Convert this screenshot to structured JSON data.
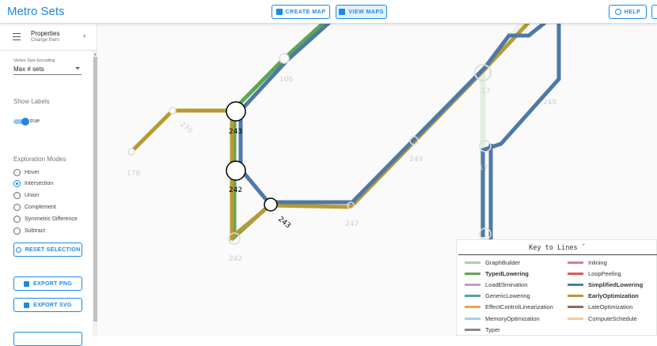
{
  "header": {
    "title": "Metro Sets",
    "create_map": "CREATE MAP",
    "view_maps": "VIEW MAPS",
    "help": "HELP"
  },
  "sidebar": {
    "panel_title": "Properties",
    "panel_subtitle": "Change them",
    "collapse_glyph": "‹",
    "vertex_label": "Vertex Size Encoding",
    "vertex_value": "Max # sets",
    "show_labels": "Show Labels",
    "toggle_value": "true",
    "exploration_title": "Exploration Modes",
    "modes": [
      {
        "label": "Hover",
        "selected": false
      },
      {
        "label": "Intersection",
        "selected": true
      },
      {
        "label": "Union",
        "selected": false
      },
      {
        "label": "Complement",
        "selected": false
      },
      {
        "label": "Symmetric Difference",
        "selected": false
      },
      {
        "label": "Subtract",
        "selected": false
      }
    ],
    "reset_button": "RESET SELECTION",
    "export_png": "EXPORT PNG",
    "export_svg": "EXPORT SVG"
  },
  "map": {
    "labels": [
      {
        "text": "106"
      },
      {
        "text": "17"
      },
      {
        "text": "248"
      },
      {
        "text": "270"
      },
      {
        "text": "243"
      },
      {
        "text": "249"
      },
      {
        "text": "178"
      },
      {
        "text": "242"
      },
      {
        "text": "243"
      },
      {
        "text": "247"
      },
      {
        "text": "242"
      },
      {
        "text": "17"
      }
    ]
  },
  "legend": {
    "title": "Key to Lines",
    "title_mark": "ˇ",
    "left": [
      {
        "label": "GraphBuilder",
        "color": "#a5d6a7",
        "bold": false
      },
      {
        "label": "TypedLowering",
        "color": "#5fa654",
        "bold": true
      },
      {
        "label": "LoadElimination",
        "color": "#c39bc7",
        "bold": false
      },
      {
        "label": "GenericLowering",
        "color": "#4fa59a",
        "bold": false
      },
      {
        "label": "EffectControlLinearization",
        "color": "#f0a24a",
        "bold": false
      },
      {
        "label": "MemoryOptimization",
        "color": "#a9cde8",
        "bold": false
      },
      {
        "label": "Typer",
        "color": "#8a8a8a",
        "bold": false
      }
    ],
    "right": [
      {
        "label": "Inlining",
        "color": "#e07a91",
        "bold": false
      },
      {
        "label": "LoopPeeling",
        "color": "#e05a4e",
        "bold": false
      },
      {
        "label": "SimplifiedLowering",
        "color": "#4e79a7",
        "bold": true
      },
      {
        "label": "EarlyOptimization",
        "color": "#b89a33",
        "bold": true
      },
      {
        "label": "LateOptimization",
        "color": "#8a6a63",
        "bold": false
      },
      {
        "label": "ComputeSchedule",
        "color": "#f6c99a",
        "bold": false
      }
    ]
  },
  "colors": {
    "accent": "#1e88e5",
    "blue_line": "#4e79a7",
    "gold_line": "#b89a33",
    "green_line": "#5fa654",
    "faint_line": "#e3efe0"
  }
}
